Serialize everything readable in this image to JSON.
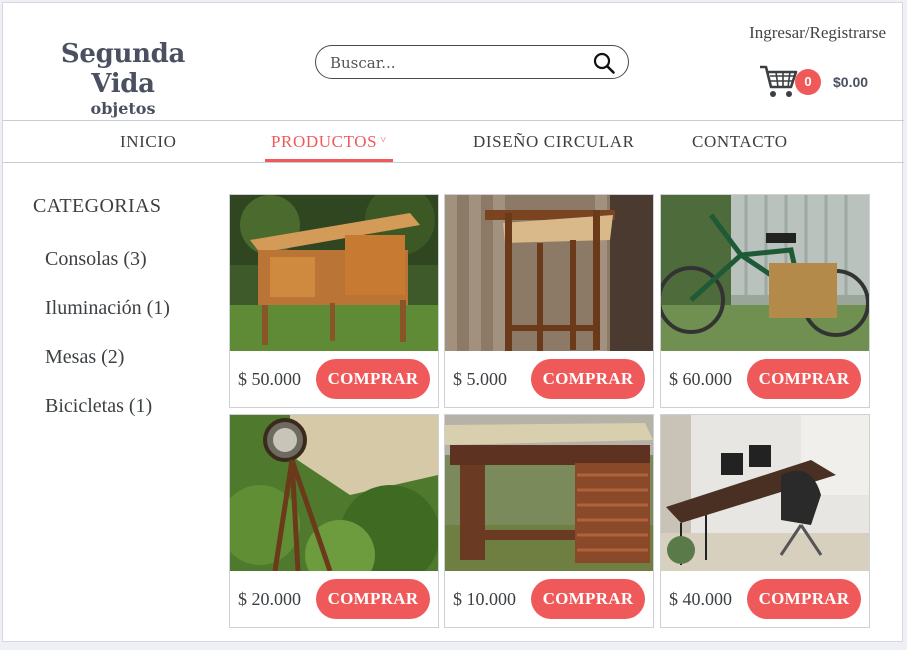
{
  "header": {
    "logo_title": "Segunda Vida",
    "logo_subtitle": "objetos",
    "search_placeholder": "Buscar...",
    "login_link": "Ingresar/Registrarse",
    "cart_count": "0",
    "cart_total": "$0.00"
  },
  "nav": {
    "items": [
      {
        "label": "INICIO"
      },
      {
        "label": "PRODUCTOS",
        "chevron": "˅"
      },
      {
        "label": "DISEÑO CIRCULAR"
      },
      {
        "label": "CONTACTO"
      }
    ]
  },
  "sidebar": {
    "title": "CATEGORIAS",
    "items": [
      {
        "label": "Consolas (3)"
      },
      {
        "label": "Iluminación (1)"
      },
      {
        "label": "Mesas (2)"
      },
      {
        "label": "Bicicletas (1)"
      }
    ]
  },
  "products": [
    {
      "price": "$ 50.000",
      "button": "COMPRAR",
      "image": "wooden-console-photo"
    },
    {
      "price": "$ 5.000",
      "button": "COMPRAR",
      "image": "wooden-stool-photo"
    },
    {
      "price": "$ 60.000",
      "button": "COMPRAR",
      "image": "green-bicycle-photo"
    },
    {
      "price": "$ 20.000",
      "button": "COMPRAR",
      "image": "tripod-lamp-photo"
    },
    {
      "price": "$ 10.000",
      "button": "COMPRAR",
      "image": "wooden-table-photo"
    },
    {
      "price": "$ 40.000",
      "button": "COMPRAR",
      "image": "desk-photo"
    }
  ],
  "colors": {
    "accent": "#f0595a",
    "text": "#3c4043",
    "border": "#c9ccd2"
  }
}
